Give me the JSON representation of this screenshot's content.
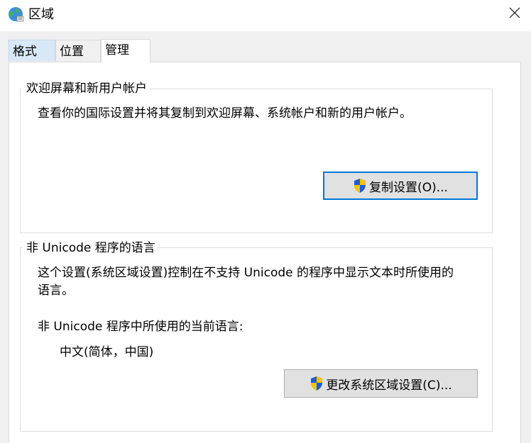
{
  "window": {
    "title": "区域",
    "title_icon": "globe-region-icon",
    "close_icon": "close-icon"
  },
  "tabs": [
    {
      "label": "格式"
    },
    {
      "label": "位置"
    },
    {
      "label": "管理",
      "selected": true
    }
  ],
  "welcome_group": {
    "legend": "欢迎屏幕和新用户帐户",
    "description": "查看你的国际设置并将其复制到欢迎屏幕、系统帐户和新的用户帐户。",
    "button_label": "复制设置(O)...",
    "button_icon": "uac-shield-icon"
  },
  "unicode_group": {
    "legend": "非 Unicode 程序的语言",
    "description_line1": "这个设置(系统区域设置)控制在不支持 Unicode 的程序中显示文本时所使用的",
    "description_line2": "语言。",
    "current_label": "非 Unicode 程序中所使用的当前语言:",
    "current_value": "中文(简体，中国)",
    "button_label": "更改系统区域设置(C)...",
    "button_icon": "uac-shield-icon"
  },
  "colors": {
    "title_bg": "#ffffff",
    "dialog_bg": "#f0f0f0",
    "accent_focus": "#0078d7",
    "hover_tab": "#d9e8f7",
    "shield_blue": "#1e5bd6",
    "shield_yellow": "#f5c400"
  }
}
